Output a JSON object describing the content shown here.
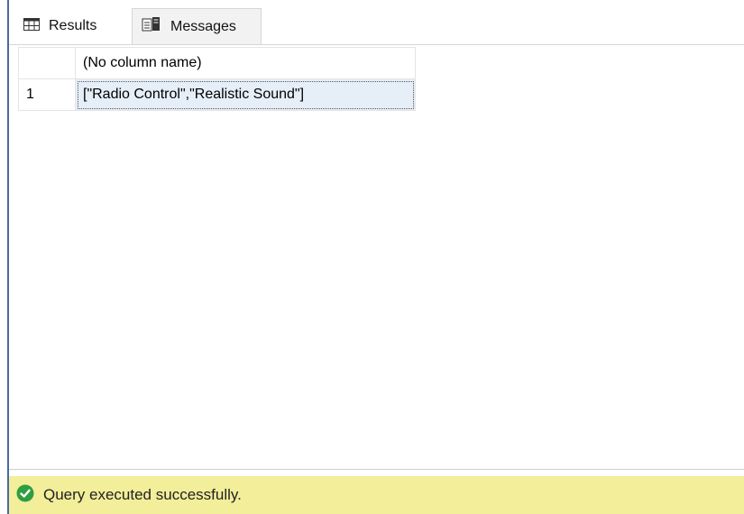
{
  "tabs": [
    {
      "label": "Results",
      "icon": "grid-icon"
    },
    {
      "label": "Messages",
      "icon": "messages-icon"
    }
  ],
  "grid": {
    "columns": [
      "(No column name)"
    ],
    "rows": [
      {
        "row_number": "1",
        "cells": [
          "[\"Radio Control\",\"Realistic Sound\"]"
        ]
      }
    ]
  },
  "status": {
    "text": "Query executed successfully.",
    "icon": "success-check-icon",
    "background_color": "#f2ee9a",
    "icon_color": "#2e9e3e"
  }
}
